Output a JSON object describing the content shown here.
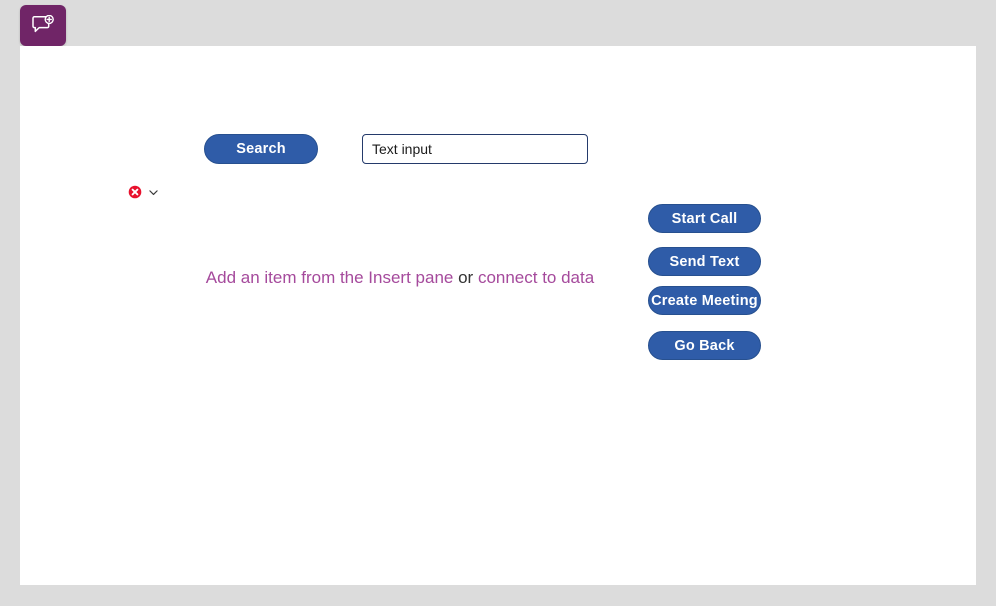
{
  "app": {
    "tile_icon": "speech-bubble-plus-icon",
    "tile_color": "#702567"
  },
  "canvas": {
    "background": "#ffffff"
  },
  "toolbar": {
    "search_label": "Search"
  },
  "search_input": {
    "value": "Text input",
    "placeholder": "Text input"
  },
  "error_row": {
    "error_icon": "error-circle-x-icon",
    "chevron_icon": "chevron-down-icon",
    "error_color": "#e8112d"
  },
  "insert_prompt": {
    "link_primary": "Add an item from the Insert pane",
    "conjunction": " or ",
    "link_secondary": "connect to data",
    "link_color": "#a54a9c"
  },
  "actions": {
    "accent_color": "#2f5ca8",
    "buttons": [
      {
        "label": "Start Call"
      },
      {
        "label": "Send Text"
      },
      {
        "label": "Create Meeting"
      },
      {
        "label": "Go Back"
      }
    ]
  }
}
